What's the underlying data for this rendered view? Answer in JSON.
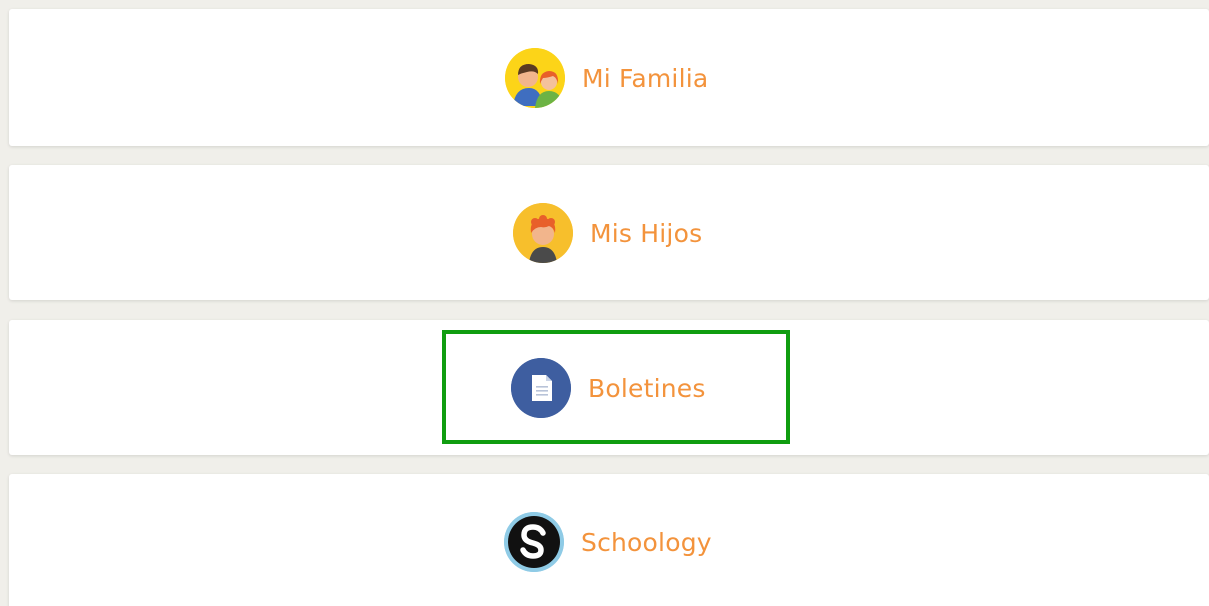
{
  "menu": {
    "items": [
      {
        "label": "Mi Familia",
        "icon": "family-icon"
      },
      {
        "label": "Mis Hijos",
        "icon": "child-icon"
      },
      {
        "label": "Boletines",
        "icon": "document-icon"
      },
      {
        "label": "Schoology",
        "icon": "schoology-logo-icon"
      }
    ],
    "highlighted_index": 2
  },
  "colors": {
    "label": "#f3933c",
    "page_background": "#f0efea",
    "card_background": "#ffffff",
    "highlight": "#109d10",
    "family_icon_bg": "#fcd418",
    "child_icon_bg": "#f7bf2c",
    "document_icon_bg": "#3e5ea0",
    "schoology_icon_bg": "#111111"
  }
}
